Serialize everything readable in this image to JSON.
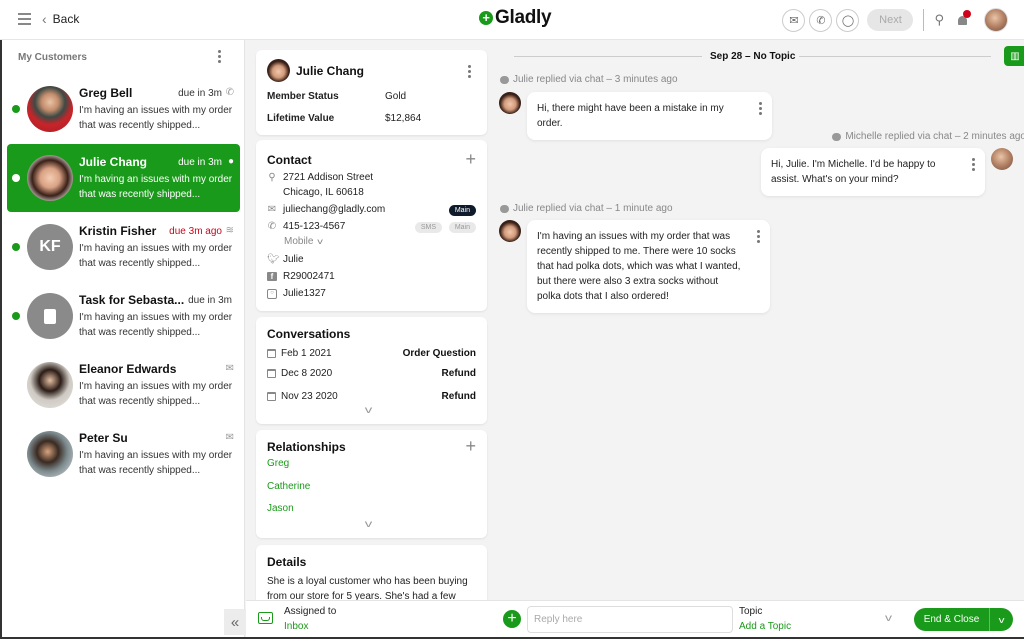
{
  "header": {
    "back_label": "Back",
    "logo_text": "Gladly",
    "next_label": "Next",
    "icons": [
      "menu-icon",
      "email-icon",
      "phone-icon",
      "chat-icon",
      "search-icon",
      "bell-icon"
    ],
    "notification_color": "#d0021b"
  },
  "theme": {
    "accent": "#1a9a1a",
    "late": "#d0021b"
  },
  "sidebar": {
    "title": "My Customers",
    "customers": [
      {
        "name": "Greg Bell",
        "due": "due in 3m",
        "channel": "phone-icon",
        "preview": "I'm having an issues with my order that was recently shipped...",
        "online": true,
        "active": false,
        "avatar": "photo"
      },
      {
        "name": "Julie Chang",
        "due": "due in 3m",
        "channel": "chat-icon",
        "preview": "I'm having an issues with my order that was recently shipped...",
        "online": true,
        "active": true,
        "avatar": "photo"
      },
      {
        "name": "Kristin Fisher",
        "due": "due 3m ago",
        "channel": "sms-icon",
        "preview": "I'm having an issues with my order that was recently shipped...",
        "online": true,
        "active": false,
        "late": true,
        "initials": "KF"
      },
      {
        "name": "Task for Sebasta...",
        "due": "due in 3m",
        "channel": "",
        "preview": "I'm having an issues with my order that was recently shipped...",
        "online": true,
        "active": false,
        "avatar": "task"
      },
      {
        "name": "Eleanor Edwards",
        "due": "",
        "channel": "email-icon",
        "preview": "I'm having an issues with my order that was recently shipped...",
        "online": false,
        "active": false,
        "avatar": "photo"
      },
      {
        "name": "Peter Su",
        "due": "",
        "channel": "email-icon",
        "preview": "I'm having an issues with my order that was recently shipped...",
        "online": false,
        "active": false,
        "avatar": "photo"
      }
    ]
  },
  "profile": {
    "name": "Julie Chang",
    "member_status_label": "Member Status",
    "member_status": "Gold",
    "lifetime_value_label": "Lifetime Value",
    "lifetime_value": "$12,864",
    "contact": {
      "title": "Contact",
      "address_line1": "2721 Addison Street",
      "address_line2": "Chicago, IL 60618",
      "email": "juliechang@gladly.com",
      "email_badge": "Main",
      "phone": "415-123-4567",
      "phone_badges": [
        "SMS",
        "Main"
      ],
      "phone_type": "Mobile",
      "twitter": "Julie",
      "facebook": "R29002471",
      "instagram": "Julie1327"
    },
    "conversations": {
      "title": "Conversations",
      "items": [
        {
          "date": "Feb 1 2021",
          "topic": "Order Question"
        },
        {
          "date": "Dec 8 2020",
          "topic": "Refund"
        },
        {
          "date": "Nov 23 2020",
          "topic": "Refund"
        }
      ]
    },
    "relationships": {
      "title": "Relationships",
      "items": [
        "Greg",
        "Catherine",
        "Jason"
      ]
    },
    "details": {
      "title": "Details",
      "text": "She is a loyal customer who has been buying from our store for 5 years. She's had a few"
    }
  },
  "chat": {
    "date_divider": "Sep 28 – No Topic",
    "messages": [
      {
        "meta": "Julie replied via chat – 3 minutes ago",
        "text": "Hi, there might have been a mistake in my order.",
        "from": "customer"
      },
      {
        "meta": "Michelle replied via chat – 2 minutes ago",
        "text": "Hi, Julie. I'm Michelle. I'd be happy to assist. What's on your mind?",
        "from": "agent"
      },
      {
        "meta": "Julie replied via chat – 1 minute ago",
        "text": "I'm having an issues with my order that was recently shipped to me. There were 10 socks that had polka dots, which was what I wanted, but there were also 3 extra socks without polka dots that I also ordered!",
        "from": "customer"
      }
    ]
  },
  "bottom": {
    "assigned_label": "Assigned to",
    "assigned_value": "Inbox",
    "reply_placeholder": "Reply here",
    "reply_value": "",
    "topic_label": "Topic",
    "topic_value": "Add a Topic",
    "end_close_label": "End & Close"
  }
}
